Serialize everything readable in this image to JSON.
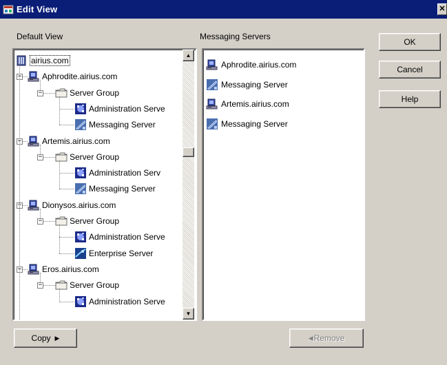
{
  "window": {
    "title": "Edit View",
    "close_glyph": "✕"
  },
  "left": {
    "label": "Default View",
    "tree": [
      {
        "text": "airius.com",
        "icon": "directory-icon",
        "level": 0,
        "selected": true
      },
      {
        "text": "Aphrodite.airius.com",
        "icon": "host-icon",
        "level": 1,
        "expander": "−"
      },
      {
        "text": "Server Group",
        "icon": "folder-icon",
        "level": 2,
        "expander": "−"
      },
      {
        "text": "Administration Serve",
        "icon": "admin-server-icon",
        "level": 3
      },
      {
        "text": "Messaging Server",
        "icon": "messaging-server-icon",
        "level": 3
      },
      {
        "text": "Artemis.airius.com",
        "icon": "host-icon",
        "level": 1,
        "expander": "−"
      },
      {
        "text": "Server Group",
        "icon": "folder-icon",
        "level": 2,
        "expander": "−"
      },
      {
        "text": "Administration Serv",
        "icon": "admin-server-icon",
        "level": 3
      },
      {
        "text": "Messaging Server",
        "icon": "messaging-server-icon",
        "level": 3
      },
      {
        "text": "Dionysos.airius.com",
        "icon": "host-icon",
        "level": 1,
        "expander": "−"
      },
      {
        "text": "Server Group",
        "icon": "folder-icon",
        "level": 2,
        "expander": "−"
      },
      {
        "text": "Administration Serve",
        "icon": "admin-server-icon",
        "level": 3
      },
      {
        "text": "Enterprise Server",
        "icon": "enterprise-server-icon",
        "level": 3
      },
      {
        "text": "Eros.airius.com",
        "icon": "host-icon",
        "level": 1,
        "expander": "−"
      },
      {
        "text": "Server Group",
        "icon": "folder-icon",
        "level": 2,
        "expander": "−"
      },
      {
        "text": "Administration Serve",
        "icon": "admin-server-icon",
        "level": 3
      }
    ],
    "scroll_up": "▲",
    "scroll_down": "▼"
  },
  "right": {
    "label": "Messaging Servers",
    "items": [
      {
        "text": "Aphrodite.airius.com",
        "icon": "host-icon"
      },
      {
        "text": "Messaging Server",
        "icon": "messaging-server-icon"
      },
      {
        "text": "Artemis.airius.com",
        "icon": "host-icon"
      },
      {
        "text": "Messaging Server",
        "icon": "messaging-server-icon"
      }
    ]
  },
  "buttons": {
    "ok": "OK",
    "cancel": "Cancel",
    "help": "Help",
    "copy": "Copy",
    "copy_arrow": "▶",
    "remove": "Remove",
    "remove_arrow": "◀"
  }
}
